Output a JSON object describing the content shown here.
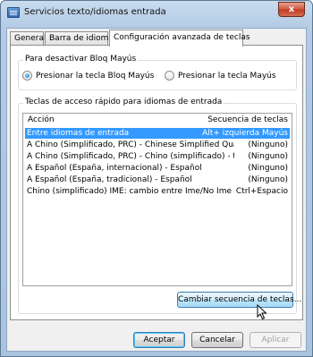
{
  "window": {
    "title": "Servicios texto/idiomas entrada",
    "close_glyph": "x"
  },
  "tabs": [
    {
      "label": "General",
      "active": false
    },
    {
      "label": "Barra de idioma",
      "active": false
    },
    {
      "label": "Configuración avanzada de teclas",
      "active": true
    }
  ],
  "caps_lock": {
    "group_label": "Para desactivar Bloq Mayús",
    "options": [
      {
        "label": "Presionar la tecla Bloq Mayús",
        "checked": true
      },
      {
        "label": "Presionar la tecla Mayús",
        "checked": false
      }
    ]
  },
  "hotkeys": {
    "group_label": "Teclas de acceso rápido para idiomas de entrada",
    "columns": {
      "action": "Acción",
      "sequence": "Secuencia de teclas"
    },
    "rows": [
      {
        "action": "Entre idiomas de entrada",
        "sequence": "Alt+ izquierda Mayús",
        "selected": true
      },
      {
        "action": "A Chino (Simplificado, PRC) - Chinese Simplified QuanPin...",
        "sequence": "(Ninguno)",
        "selected": false
      },
      {
        "action": "A Chino (Simplificado, PRC) - Chino (simplificado) - tecla...",
        "sequence": "(Ninguno)",
        "selected": false
      },
      {
        "action": "A Español (España, internacional) - Español",
        "sequence": "(Ninguno)",
        "selected": false
      },
      {
        "action": "A Español (España, tradicional) - Español",
        "sequence": "(Ninguno)",
        "selected": false
      },
      {
        "action": "Chino (simplificado) IME: cambio entre Ime/No Ime",
        "sequence": "Ctrl+Espacio",
        "selected": false
      }
    ],
    "change_button": "Cambiar secuencia de teclas..."
  },
  "footer": {
    "ok": "Aceptar",
    "cancel": "Cancelar",
    "apply": "Aplicar"
  }
}
